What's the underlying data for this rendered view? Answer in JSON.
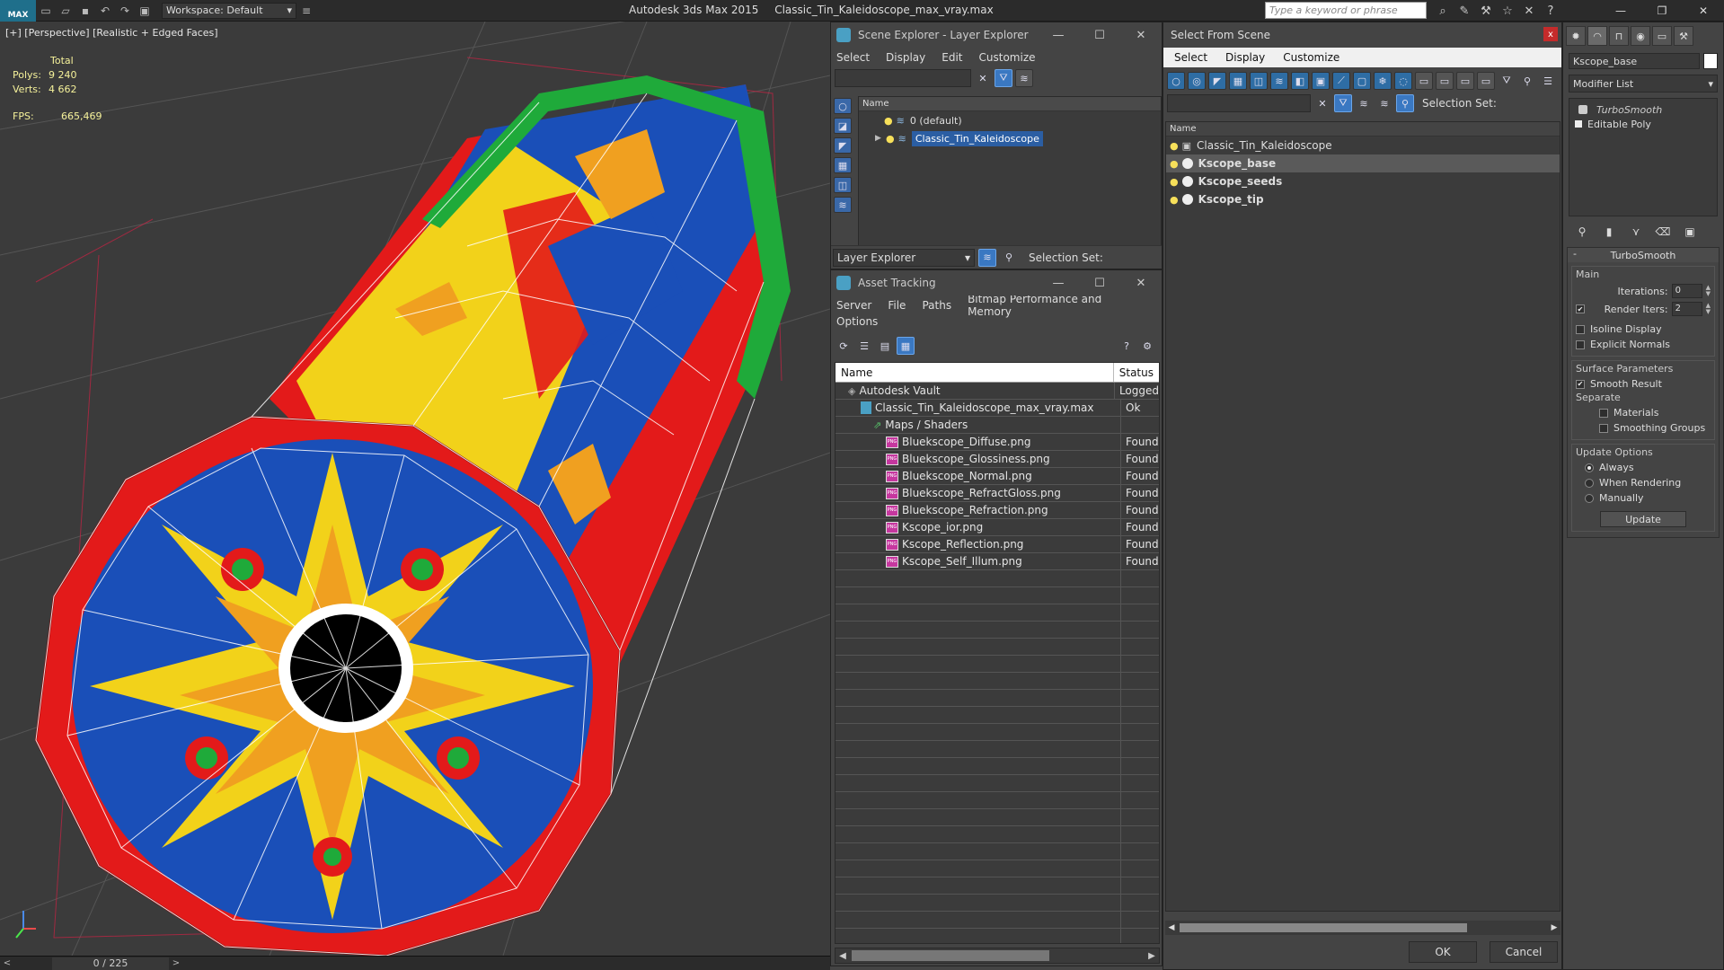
{
  "titlebar": {
    "logo": "MAX",
    "workspace": "Workspace: Default",
    "app_name": "Autodesk 3ds Max  2015",
    "file_name": "Classic_Tin_Kaleidoscope_max_vray.max",
    "search_placeholder": "Type a keyword or phrase"
  },
  "viewport": {
    "label": "[+] [Perspective] [Realistic + Edged Faces]",
    "stats": {
      "total_label": "Total",
      "polys_label": "Polys:",
      "polys_value": "9 240",
      "verts_label": "Verts:",
      "verts_value": "4 662",
      "fps_label": "FPS:",
      "fps_value": "665,469"
    },
    "colors": {
      "tube_red": "#e31a1a",
      "tube_blue": "#1a4fb8",
      "tube_yellow": "#f2d21a",
      "tube_green": "#1faa3a",
      "star_orange": "#f0a020"
    }
  },
  "timeline": {
    "frame": "0 / 225",
    "prev": "<",
    "next": ">"
  },
  "scene_explorer": {
    "title": "Scene Explorer - Layer Explorer",
    "menu": [
      "Select",
      "Display",
      "Edit",
      "Customize"
    ],
    "column": "Name",
    "layers": [
      {
        "name": "0 (default)",
        "selected": false
      },
      {
        "name": "Classic_Tin_Kaleidoscope",
        "selected": true
      }
    ],
    "footer_dropdown": "Layer Explorer",
    "selection_set": "Selection Set:"
  },
  "asset_tracking": {
    "title": "Asset Tracking",
    "menu": [
      "Server",
      "File",
      "Paths",
      "Bitmap Performance and Memory"
    ],
    "menu2": "Options",
    "columns": {
      "name": "Name",
      "status": "Status"
    },
    "rows": [
      {
        "name": "Autodesk Vault",
        "status": "Logged",
        "kind": "vault",
        "indent": 1
      },
      {
        "name": "Classic_Tin_Kaleidoscope_max_vray.max",
        "status": "Ok",
        "kind": "file",
        "indent": 2
      },
      {
        "name": "Maps / Shaders",
        "status": "",
        "kind": "folder",
        "indent": 3
      },
      {
        "name": "Bluekscope_Diffuse.png",
        "status": "Found",
        "kind": "png",
        "indent": 4
      },
      {
        "name": "Bluekscope_Glossiness.png",
        "status": "Found",
        "kind": "png",
        "indent": 4
      },
      {
        "name": "Bluekscope_Normal.png",
        "status": "Found",
        "kind": "png",
        "indent": 4
      },
      {
        "name": "Bluekscope_RefractGloss.png",
        "status": "Found",
        "kind": "png",
        "indent": 4
      },
      {
        "name": "Bluekscope_Refraction.png",
        "status": "Found",
        "kind": "png",
        "indent": 4
      },
      {
        "name": "Kscope_ior.png",
        "status": "Found",
        "kind": "png",
        "indent": 4
      },
      {
        "name": "Kscope_Reflection.png",
        "status": "Found",
        "kind": "png",
        "indent": 4
      },
      {
        "name": "Kscope_Self_Illum.png",
        "status": "Found",
        "kind": "png",
        "indent": 4
      }
    ]
  },
  "select_from_scene": {
    "title": "Select From Scene",
    "close": "x",
    "menu": [
      "Select",
      "Display",
      "Customize"
    ],
    "selection_set": "Selection Set:",
    "column": "Name",
    "items": [
      {
        "name": "Classic_Tin_Kaleidoscope",
        "kind": "group",
        "selected": false,
        "bold": false
      },
      {
        "name": "Kscope_base",
        "kind": "object",
        "selected": true,
        "bold": true
      },
      {
        "name": "Kscope_seeds",
        "kind": "object",
        "selected": false,
        "bold": true
      },
      {
        "name": "Kscope_tip",
        "kind": "object",
        "selected": false,
        "bold": true
      }
    ],
    "ok": "OK",
    "cancel": "Cancel"
  },
  "command_panel": {
    "object_name": "Kscope_base",
    "modifier_list": "Modifier List",
    "stack": [
      "TurboSmooth",
      "Editable Poly"
    ],
    "rollout_title": "TurboSmooth",
    "main_group": "Main",
    "iterations_label": "Iterations:",
    "iterations_value": "0",
    "render_iters_label": "Render Iters:",
    "render_iters_value": "2",
    "isoline_label": "Isoline Display",
    "explicit_label": "Explicit Normals",
    "surface_group": "Surface Parameters",
    "smooth_label": "Smooth Result",
    "separate_label": "Separate",
    "materials_label": "Materials",
    "smoothing_label": "Smoothing Groups",
    "update_group": "Update Options",
    "always_label": "Always",
    "when_rendering_label": "When Rendering",
    "manually_label": "Manually",
    "update_button": "Update"
  }
}
